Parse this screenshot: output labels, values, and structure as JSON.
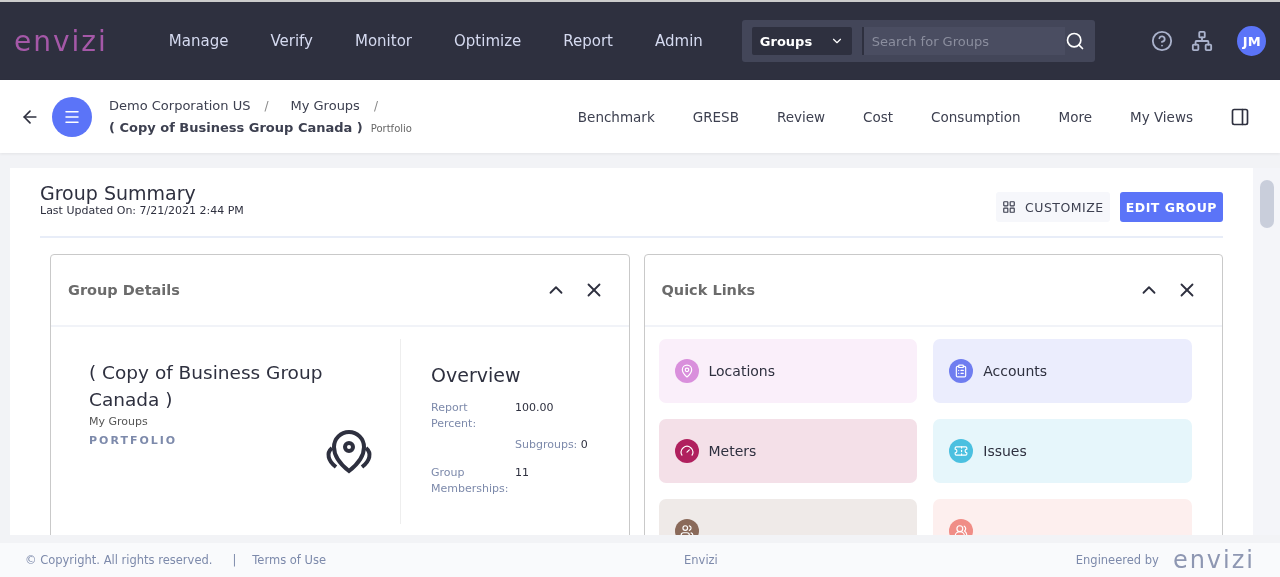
{
  "header": {
    "logo": "envizi",
    "nav": [
      "Manage",
      "Verify",
      "Monitor",
      "Optimize",
      "Report",
      "Admin"
    ],
    "search": {
      "scope": "Groups",
      "placeholder": "Search for Groups"
    },
    "avatar": "JM"
  },
  "subheader": {
    "breadcrumbs": [
      "Demo Corporation US",
      "My Groups"
    ],
    "separator": "/",
    "title": "( Copy of Business Group Canada )",
    "type": "Portfolio",
    "tabs": [
      "Benchmark",
      "GRESB",
      "Review",
      "Cost",
      "Consumption",
      "More",
      "My Views"
    ]
  },
  "summary": {
    "title": "Group Summary",
    "updated": "Last Updated On: 7/21/2021 2:44 PM",
    "buttons": [
      {
        "label": "CUSTOMIZE",
        "kind": "secondary"
      },
      {
        "label": "EDIT GROUP",
        "kind": "primary"
      }
    ]
  },
  "group_details": {
    "title": "Group Details",
    "name": "( Copy of Business Group Canada )",
    "parent": "My Groups",
    "type": "PORTFOLIO",
    "overview_title": "Overview",
    "overview": [
      {
        "label": "Report Percent:",
        "value": "100.00",
        "kind": "pair"
      },
      {
        "label": "Subgroups:",
        "value": "0",
        "kind": "inline"
      },
      {
        "label": "Group Memberships:",
        "value": "11",
        "kind": "pair"
      }
    ]
  },
  "quick_links": {
    "title": "Quick Links",
    "items": [
      {
        "label": "Locations",
        "color": "#d98fdc",
        "kind": "location"
      },
      {
        "label": "Accounts",
        "color": "#6f7df0",
        "kind": "account"
      },
      {
        "label": "Meters",
        "color": "#b0205e",
        "kind": "meter"
      },
      {
        "label": "Issues",
        "color": "#4bc0e0",
        "kind": "issue"
      },
      {
        "color": "#8a6a5a",
        "kind": "subgroup"
      },
      {
        "color": "#f08d86",
        "kind": "membership"
      }
    ]
  },
  "footer": {
    "copyright": "© Copyright. All rights reserved.",
    "separator": "|",
    "terms": "Terms of Use",
    "center": "Envizi",
    "engineered": "Engineered by",
    "logo": "envizi"
  }
}
